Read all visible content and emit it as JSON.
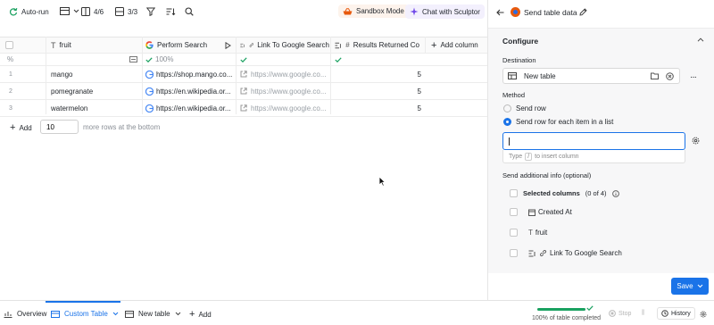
{
  "toolbar": {
    "autorun": "Auto-run",
    "columns_count": "4/6",
    "rows_count": "3/3",
    "sandbox": "Sandbox Mode",
    "chat": "Chat with Sculptor"
  },
  "table": {
    "headers": [
      "fruit",
      "Perform Search",
      "Link To Google Search",
      "Results Returned Co",
      "Add column"
    ],
    "summary": {
      "index": "%",
      "search_pct": "100%"
    },
    "rows": [
      {
        "n": "1",
        "fruit": "mango",
        "search": "https://shop.mango.co...",
        "link": "https://www.google.co...",
        "results": "5"
      },
      {
        "n": "2",
        "fruit": "pomegranate",
        "search": "https://en.wikipedia.or...",
        "link": "https://www.google.co...",
        "results": "5"
      },
      {
        "n": "3",
        "fruit": "watermelon",
        "search": "https://en.wikipedia.or...",
        "link": "https://www.google.co...",
        "results": "5"
      }
    ],
    "add_label": "Add",
    "add_count": "10",
    "add_suffix": "more rows at the bottom"
  },
  "panel": {
    "title": "Send table data",
    "configure": "Configure",
    "destination_label": "Destination",
    "destination_value": "New table",
    "method_label": "Method",
    "method_row": "Send row",
    "method_list": "Send row for each item in a list",
    "hint_prefix": "Type",
    "hint_key": "/",
    "hint_suffix": "to insert column",
    "additional": "Send additional info (optional)",
    "selected_columns": "Selected columns",
    "selected_count": "(0 of 4)",
    "columns": [
      "Created At",
      "fruit",
      "Link To Google Search"
    ],
    "save": "Save"
  },
  "bottom": {
    "overview": "Overview",
    "custom_table": "Custom Table",
    "new_table": "New table",
    "add": "Add",
    "progress_text": "100% of table completed",
    "progress": 1.0,
    "stop": "Stop",
    "history": "History"
  },
  "colors": {
    "accent": "#1a73e8",
    "green": "#1aa160",
    "sandbox": "#e8590c",
    "chat": "#7048e8"
  }
}
